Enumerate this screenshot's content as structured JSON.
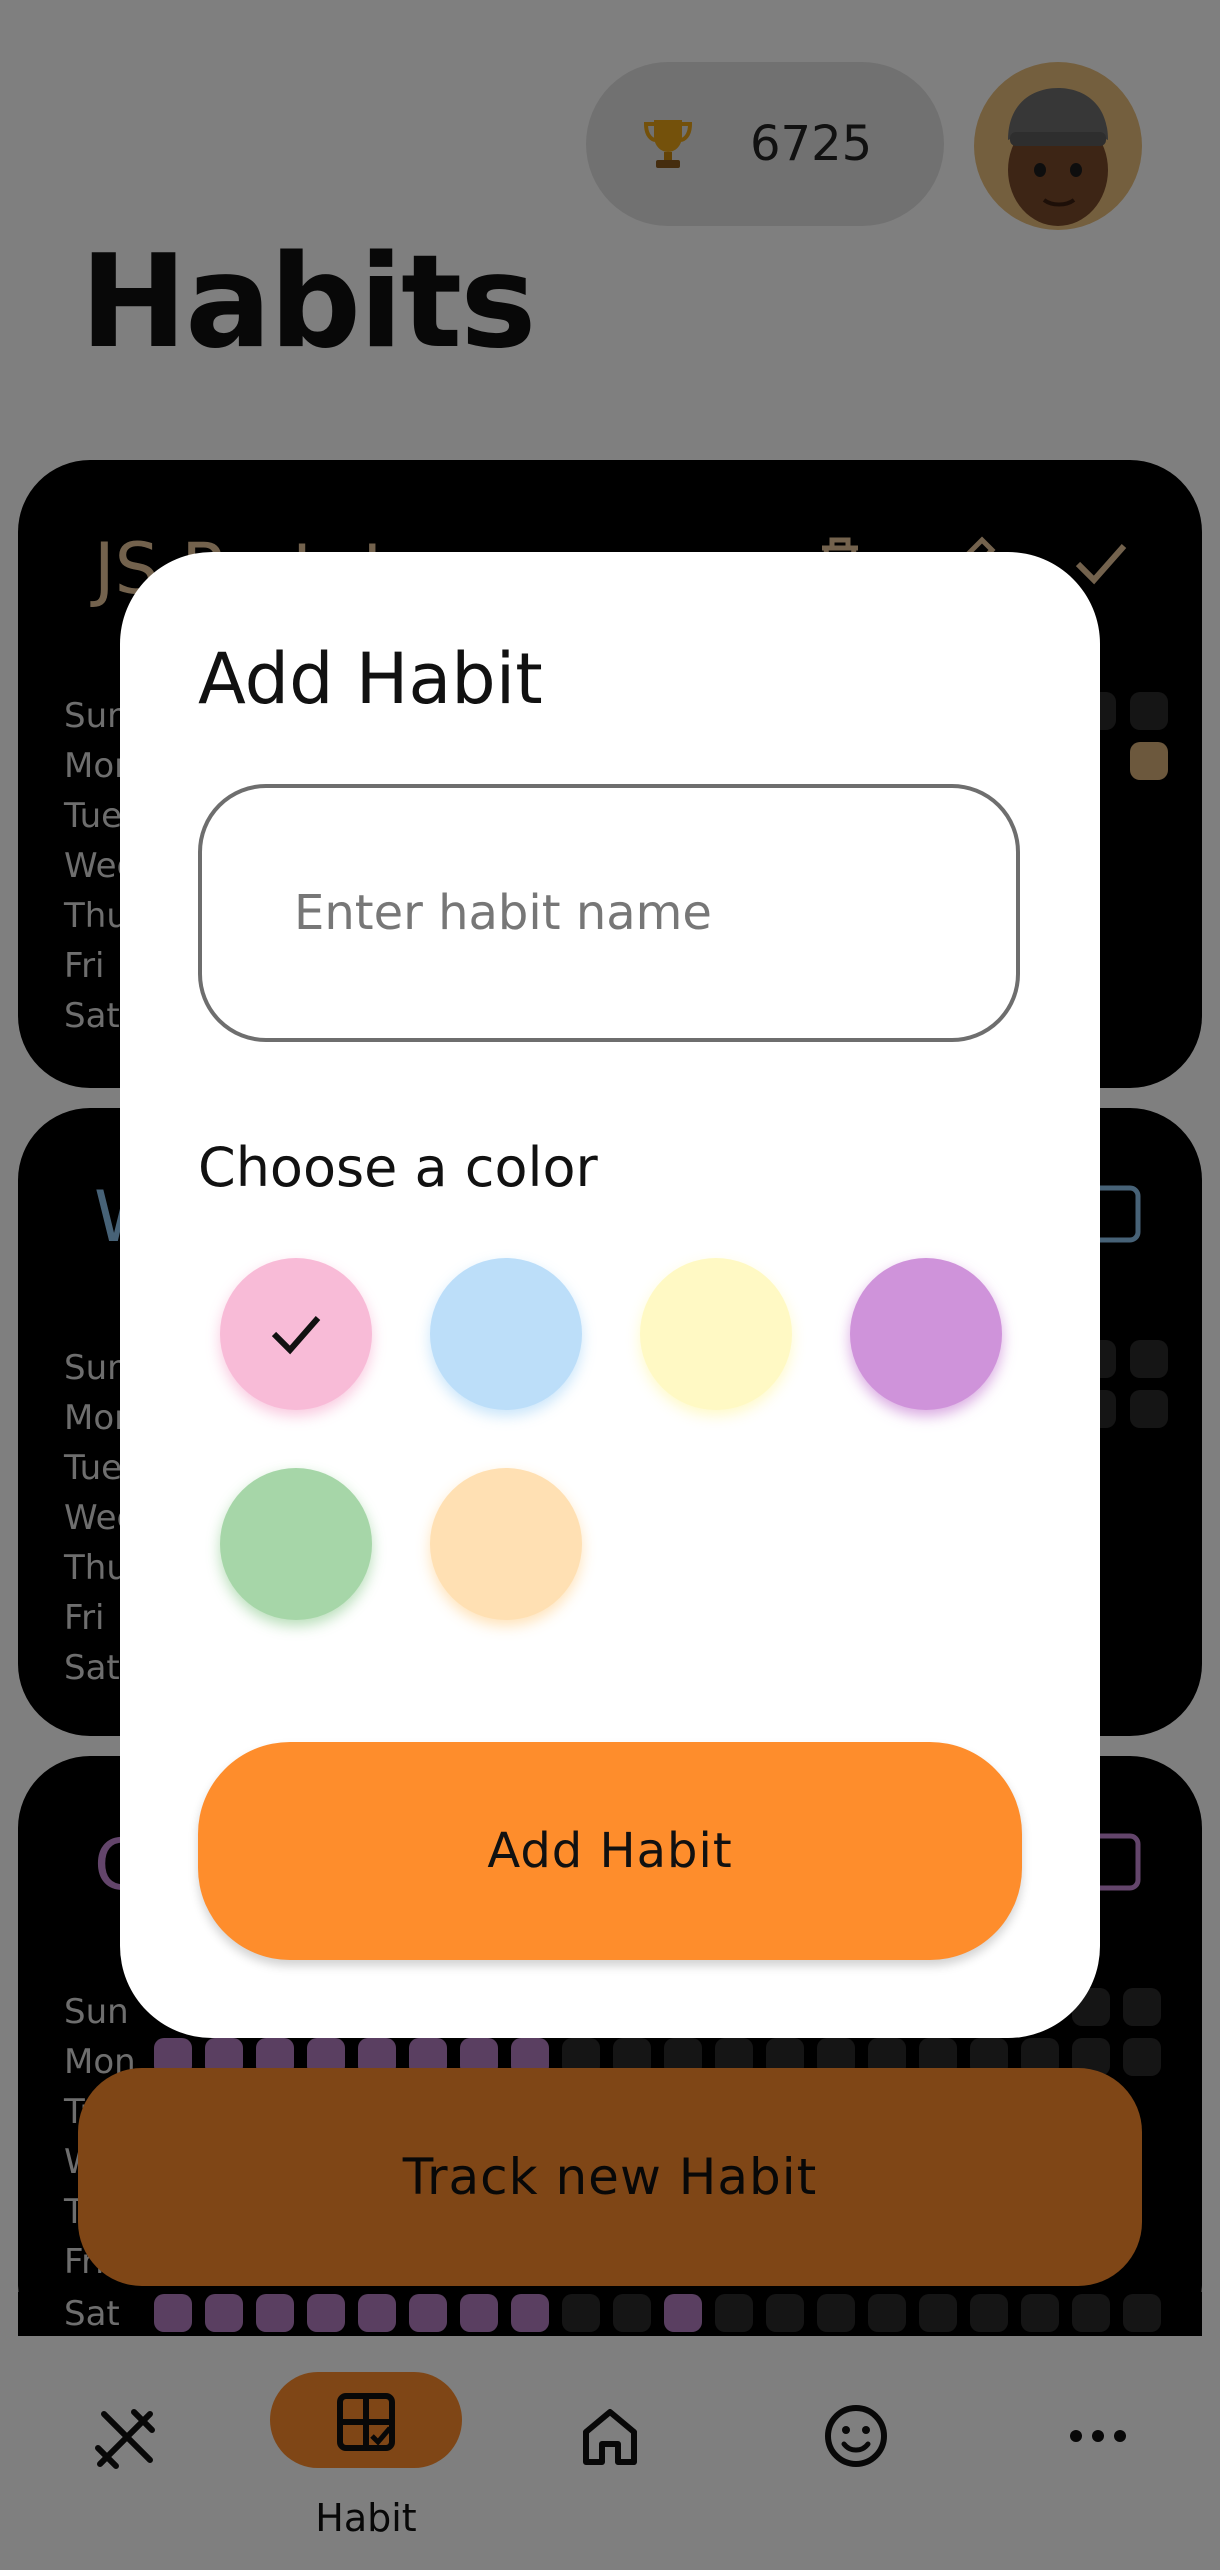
{
  "header": {
    "trophy_icon": "trophy-icon",
    "score": "6725",
    "avatar_icon": "memoji-avatar"
  },
  "page_title": "Habits",
  "cards": [
    {
      "title": "JS Prototype",
      "title_color": "#e6c59a",
      "actions": [
        "trash-icon",
        "edit-icon",
        "check-icon"
      ],
      "days": [
        "Sun",
        "Mon",
        "Tue",
        "Wed",
        "Thu",
        "Fri",
        "Sat"
      ]
    },
    {
      "title": "W",
      "title_color": "#8fc4ef",
      "days": [
        "Sun",
        "Mon",
        "Tue",
        "Wed",
        "Thu",
        "Fri",
        "Sat"
      ]
    },
    {
      "title": "C",
      "title_color": "#c68bd6",
      "days": [
        "Sun",
        "Mon",
        "Tue",
        "Wed",
        "Thu",
        "Fri",
        "Sat"
      ],
      "filled_color": "#c68bd6"
    }
  ],
  "track_button": {
    "label": "Track new Habit",
    "color": "#fe8d2c"
  },
  "modal": {
    "title": "Add Habit",
    "name_placeholder": "Enter habit name",
    "name_value": "",
    "color_label": "Choose a color",
    "colors": [
      {
        "name": "pink",
        "hex": "#f8bbd7",
        "selected": true
      },
      {
        "name": "blue",
        "hex": "#bcdef9",
        "selected": false
      },
      {
        "name": "yellow",
        "hex": "#fff9c4",
        "selected": false
      },
      {
        "name": "purple",
        "hex": "#cf93da",
        "selected": false
      },
      {
        "name": "green",
        "hex": "#a6d6a8",
        "selected": false
      },
      {
        "name": "peach",
        "hex": "#ffe0b3",
        "selected": false
      }
    ],
    "submit_label": "Add Habit",
    "accent": "#fe8d2c"
  },
  "bottom_nav": {
    "items": [
      {
        "icon": "tools-icon",
        "label": ""
      },
      {
        "icon": "habit-grid-icon",
        "label": "Habit",
        "active": true
      },
      {
        "icon": "home-icon",
        "label": ""
      },
      {
        "icon": "smiley-icon",
        "label": ""
      },
      {
        "icon": "more-icon",
        "label": ""
      }
    ]
  }
}
